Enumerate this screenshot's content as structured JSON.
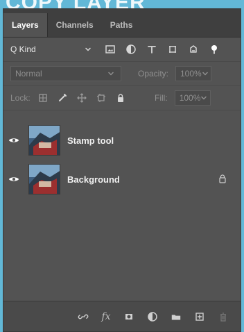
{
  "banner": {
    "text": "COPY LAYER"
  },
  "panel": {
    "tabs": [
      {
        "label": "Layers",
        "active": true
      },
      {
        "label": "Channels",
        "active": false
      },
      {
        "label": "Paths",
        "active": false
      }
    ],
    "filter": {
      "kind_label": "Q Kind",
      "icons": [
        "image-filter-icon",
        "adjustment-filter-icon",
        "type-filter-icon",
        "shape-filter-icon",
        "smart-object-filter-icon",
        "toggle-filter-icon"
      ]
    },
    "blend": {
      "mode": "Normal",
      "opacity_label": "Opacity:",
      "opacity_value": "100%"
    },
    "lock": {
      "label": "Lock:",
      "fill_label": "Fill:",
      "fill_value": "100%"
    },
    "layers": [
      {
        "name": "Stamp tool",
        "visible": true,
        "locked": false
      },
      {
        "name": "Background",
        "visible": true,
        "locked": true
      }
    ],
    "footer_icons": [
      "link-icon",
      "fx-icon",
      "mask-icon",
      "adjustment-icon",
      "folder-icon",
      "new-layer-icon",
      "trash-icon"
    ]
  },
  "colors": {
    "outer_bg": "#62b8d7",
    "panel_bg": "#535353",
    "tab_bar_bg": "#3f3f3f",
    "text_primary": "#f0f0f0",
    "text_muted": "#8f8f8f"
  }
}
